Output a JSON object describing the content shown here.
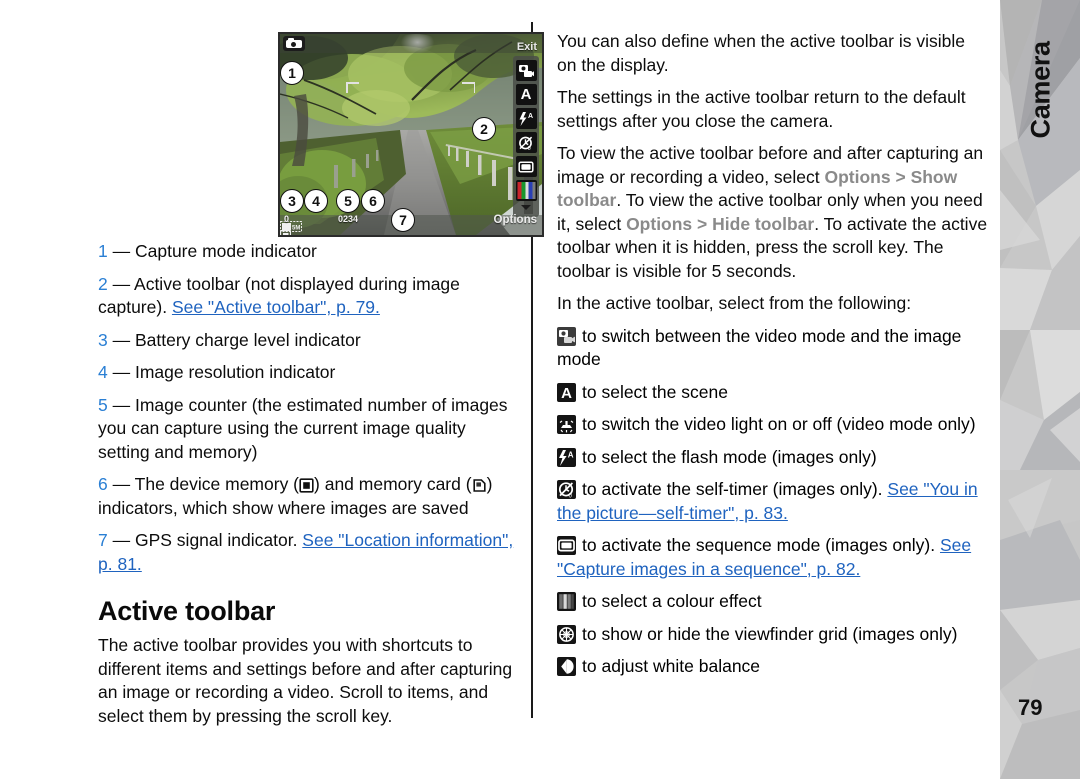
{
  "sidebar": {
    "section_title": "Camera",
    "page_number": "79"
  },
  "figure": {
    "alt_name": "camera-viewfinder-illustration",
    "status_bar": {
      "exit_label": "Exit",
      "options_label": "Options",
      "exposure_value": "0",
      "image_counter": "0234",
      "resolution_label": "5 M"
    },
    "callouts": [
      "1",
      "2",
      "3",
      "4",
      "5",
      "6",
      "7"
    ],
    "toolbar_icons": [
      "video-image-mode-toggle-icon",
      "scene-mode-icon",
      "flash-mode-icon",
      "self-timer-icon",
      "sequence-mode-icon",
      "colour-effect-icon",
      "toolbar-more-caret-icon"
    ]
  },
  "left_column": {
    "legend": [
      {
        "num": "1",
        "dash": "—",
        "text": "Capture mode indicator"
      },
      {
        "num": "2",
        "dash": "—",
        "text": "Active toolbar (not displayed during image capture). ",
        "link": "See \"Active toolbar\", p. 79."
      },
      {
        "num": "3",
        "dash": "—",
        "text": "Battery charge level indicator"
      },
      {
        "num": "4",
        "dash": "—",
        "text": "Image resolution indicator"
      },
      {
        "num": "5",
        "dash": "—",
        "text": "Image counter (the estimated number of images you can capture using the current image quality setting and memory)"
      },
      {
        "num": "6",
        "dash": "—",
        "text_a": "The device memory (",
        "text_b": ") and memory card (",
        "text_c": ") indicators, which show where images are saved"
      },
      {
        "num": "7",
        "dash": "—",
        "text": "GPS signal indicator. ",
        "link": "See \"Location information\", p. 81."
      }
    ],
    "heading": "Active toolbar",
    "body": "The active toolbar provides you with shortcuts to different items and settings before and after capturing an image or recording a video. Scroll to items, and select them by pressing the scroll key."
  },
  "right_column": {
    "paragraphs": [
      "You can also define when the active toolbar is visible on the display.",
      "The settings in the active toolbar return to the default settings after you close the camera."
    ],
    "toolbar_paragraph": {
      "p1": "To view the active toolbar before and after capturing an image or recording a video, select ",
      "ui1": "Options",
      "gt1": " > ",
      "ui2": "Show toolbar",
      "p2": ". To view the active toolbar only when you need it, select ",
      "ui3": "Options",
      "gt2": " > ",
      "ui4": "Hide toolbar",
      "p3": ". To activate the active toolbar when it is hidden, press the scroll key. The toolbar is visible for 5 seconds."
    },
    "lead_in": "In the active toolbar, select from the following:",
    "items": [
      {
        "icon": "video-image-mode-toggle-icon",
        "text": "to switch between the video mode and the image mode"
      },
      {
        "icon": "scene-mode-icon",
        "text": "to select the scene"
      },
      {
        "icon": "video-light-icon",
        "text": "to switch the video light on or off (video mode only)"
      },
      {
        "icon": "flash-mode-icon",
        "text": "to select the flash mode (images only)"
      },
      {
        "icon": "self-timer-icon",
        "text": "to activate the self-timer (images only). ",
        "link": "See \"You in the picture—self-timer\", p. 83."
      },
      {
        "icon": "sequence-mode-icon",
        "text": "to activate the sequence mode (images only). ",
        "link": "See \"Capture images in a sequence\", p. 82."
      },
      {
        "icon": "colour-effect-icon",
        "text": "to select a colour effect"
      },
      {
        "icon": "viewfinder-grid-icon",
        "text": "to show or hide the viewfinder grid (images only)"
      },
      {
        "icon": "white-balance-icon",
        "text": "to adjust white balance"
      }
    ]
  },
  "colors": {
    "link": "#1f63bf",
    "callout_number": "#2a7fd4",
    "ui_term": "#8a8a8a",
    "sidebar_bg": "#c9c9c9"
  }
}
